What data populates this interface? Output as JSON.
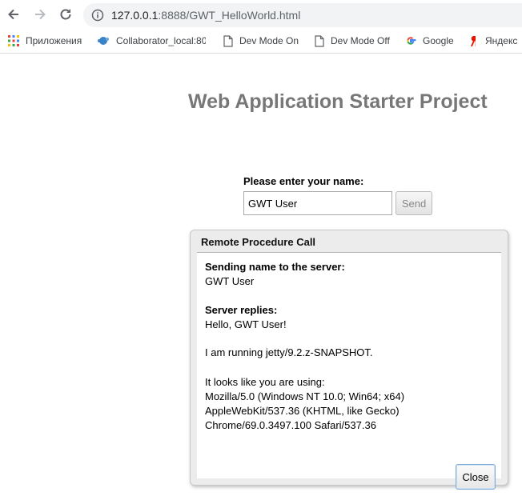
{
  "browser": {
    "url_host": "127.0.0.1",
    "url_rest": ":8888/GWT_HelloWorld.html",
    "bookmarks": [
      {
        "label": "Приложения",
        "icon": "apps-grid-icon"
      },
      {
        "label": "Collaborator_local:80",
        "icon": "collaborator-icon"
      },
      {
        "label": "Dev Mode On",
        "icon": "page-icon"
      },
      {
        "label": "Dev Mode Off",
        "icon": "page-icon"
      },
      {
        "label": "Google",
        "icon": "google-icon"
      },
      {
        "label": "Яндекс",
        "icon": "yandex-icon"
      }
    ]
  },
  "page": {
    "title": "Web Application Starter Project",
    "name_label": "Please enter your name:",
    "name_value": "GWT User",
    "send_label": "Send"
  },
  "dialog": {
    "caption": "Remote Procedure Call",
    "sending_heading": "Sending name to the server:",
    "sending_value": "GWT User",
    "replies_heading": "Server replies:",
    "reply_line1": "Hello, GWT User!",
    "reply_line2": "I am running jetty/9.2.z-SNAPSHOT.",
    "reply_line3": "It looks like you are using:",
    "ua_line1": "Mozilla/5.0 (Windows NT 10.0; Win64; x64)",
    "ua_line2": "AppleWebKit/537.36 (KHTML, like Gecko)",
    "ua_line3": "Chrome/69.0.3497.100 Safari/537.36",
    "close_label": "Close"
  },
  "colors": {
    "title": "#777777",
    "dialog_bg": "#ececec",
    "close_border": "#7fa9d6"
  }
}
